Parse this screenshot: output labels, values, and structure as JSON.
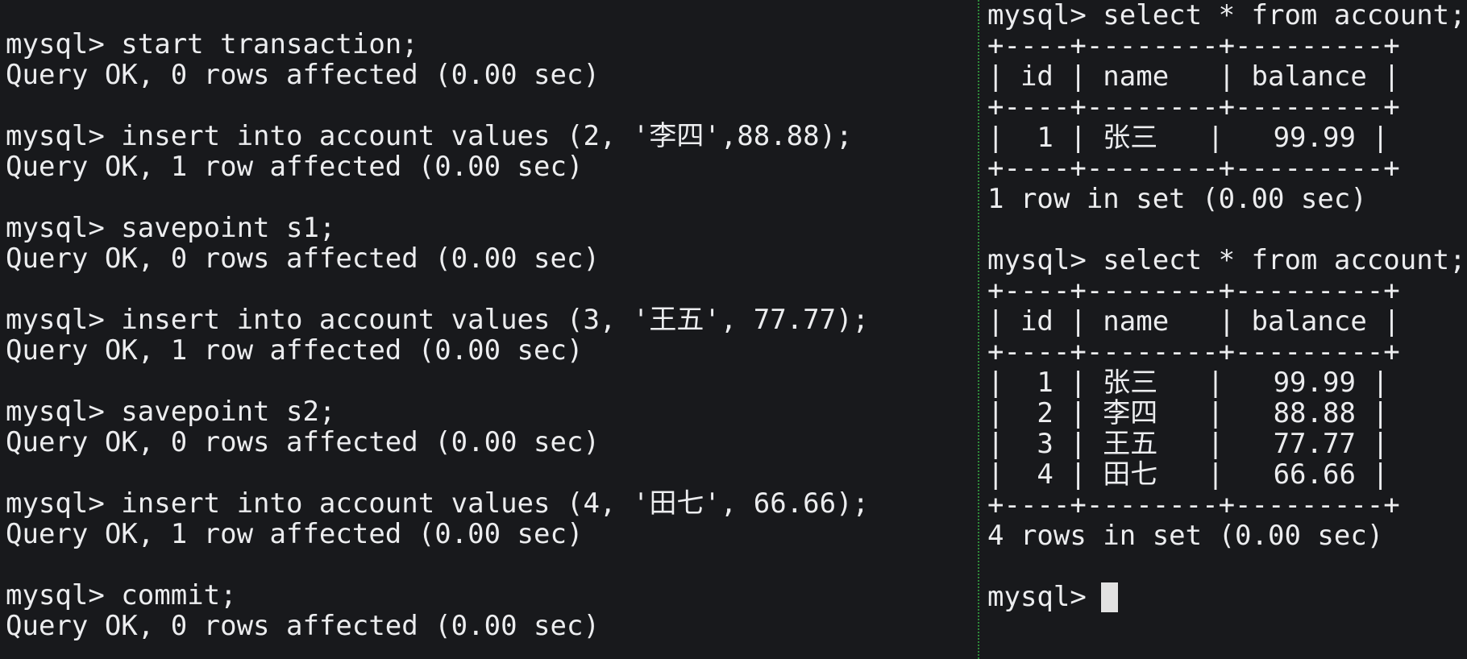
{
  "left_pane": {
    "lines": [
      "mysql> start transaction;",
      "Query OK, 0 rows affected (0.00 sec)",
      "",
      "mysql> insert into account values (2, '李四',88.88);",
      "Query OK, 1 row affected (0.00 sec)",
      "",
      "mysql> savepoint s1;",
      "Query OK, 0 rows affected (0.00 sec)",
      "",
      "mysql> insert into account values (3, '王五', 77.77);",
      "Query OK, 1 row affected (0.00 sec)",
      "",
      "mysql> savepoint s2;",
      "Query OK, 0 rows affected (0.00 sec)",
      "",
      "mysql> insert into account values (4, '田七', 66.66);",
      "Query OK, 1 row affected (0.00 sec)",
      "",
      "mysql> commit;",
      "Query OK, 0 rows affected (0.00 sec)"
    ]
  },
  "right_pane": {
    "lines": [
      "mysql> select * from account;",
      "+----+--------+---------+",
      "| id | name   | balance |",
      "+----+--------+---------+",
      "|  1 | 张三   |   99.99 |",
      "+----+--------+---------+",
      "1 row in set (0.00 sec)",
      "",
      "mysql> select * from account;",
      "+----+--------+---------+",
      "| id | name   | balance |",
      "+----+--------+---------+",
      "|  1 | 张三   |   99.99 |",
      "|  2 | 李四   |   88.88 |",
      "|  3 | 王五   |   77.77 |",
      "|  4 | 田七   |   66.66 |",
      "+----+--------+---------+",
      "4 rows in set (0.00 sec)",
      "",
      "mysql> "
    ]
  },
  "colors": {
    "background": "#18191c",
    "foreground": "#ecedef",
    "divider": "#2f8a3a",
    "cursor": "#e2e2e2"
  }
}
